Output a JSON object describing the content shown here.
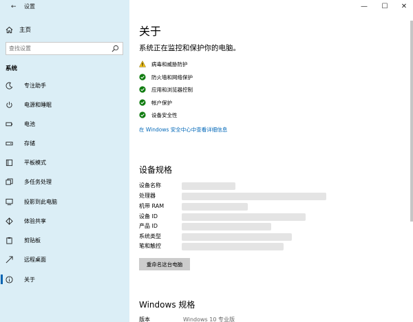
{
  "window": {
    "title": "设置",
    "controls": {
      "minimize": "—",
      "maximize": "☐",
      "close": "✕"
    }
  },
  "sidebar": {
    "home_label": "主页",
    "search_placeholder": "查找设置",
    "section_title": "系统",
    "items": [
      {
        "label": "专注助手",
        "icon": "moon-icon"
      },
      {
        "label": "电源和睡眠",
        "icon": "power-icon"
      },
      {
        "label": "电池",
        "icon": "battery-icon"
      },
      {
        "label": "存储",
        "icon": "storage-icon"
      },
      {
        "label": "平板模式",
        "icon": "tablet-icon"
      },
      {
        "label": "多任务处理",
        "icon": "multitask-icon"
      },
      {
        "label": "投影到此电脑",
        "icon": "project-icon"
      },
      {
        "label": "体验共享",
        "icon": "share-icon"
      },
      {
        "label": "剪贴板",
        "icon": "clipboard-icon"
      },
      {
        "label": "远程桌面",
        "icon": "remote-desktop-icon"
      },
      {
        "label": "关于",
        "icon": "info-icon",
        "active": true
      }
    ]
  },
  "main": {
    "title": "关于",
    "subtitle": "系统正在监控和保护你的电脑。",
    "status": [
      {
        "label": "病毒和威胁防护",
        "state": "warning"
      },
      {
        "label": "防火墙和网络保护",
        "state": "ok"
      },
      {
        "label": "应用和浏览器控制",
        "state": "ok"
      },
      {
        "label": "帐户保护",
        "state": "ok"
      },
      {
        "label": "设备安全性",
        "state": "ok"
      }
    ],
    "security_link": "在 Windows 安全中心中查看详细信息",
    "device_specs_title": "设备规格",
    "device_specs": [
      {
        "label": "设备名称"
      },
      {
        "label": "处理器"
      },
      {
        "label": "机带 RAM"
      },
      {
        "label": "设备 ID"
      },
      {
        "label": "产品 ID"
      },
      {
        "label": "系统类型"
      },
      {
        "label": "笔和触控"
      }
    ],
    "rename_button": "重命名这台电脑",
    "windows_specs_title": "Windows 规格",
    "windows_specs": [
      {
        "label": "版本",
        "value": "Windows 10 专业版"
      }
    ]
  },
  "colors": {
    "sidebar_bg": "#dbeef6",
    "accent": "#0063b1",
    "link": "#0067b8",
    "ok": "#107c10",
    "warning": "#f5c518"
  }
}
